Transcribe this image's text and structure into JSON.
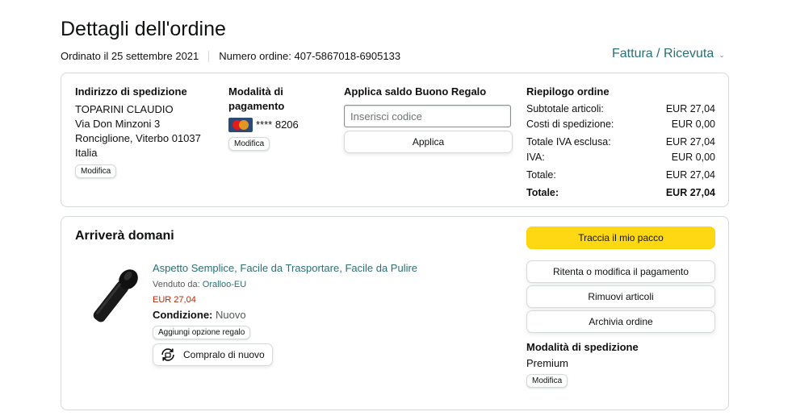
{
  "header": {
    "title": "Dettagli dell'ordine",
    "ordered_on": "Ordinato il 25 settembre 2021",
    "order_number": "Numero ordine: 407-5867018-6905133",
    "invoice_label": "Fattura / Ricevuta"
  },
  "shipping_address": {
    "title": "Indirizzo di spedizione",
    "name": "TOPARINI CLAUDIO",
    "street": "Via Don Minzoni 3",
    "city": "Ronciglione, Viterbo 01037",
    "country": "Italia",
    "edit_label": "Modifica"
  },
  "payment": {
    "title_line1": "Modalità di",
    "title_line2": "pagamento",
    "card_brand": "mastercard",
    "card_digits": "**** 8206",
    "edit_label": "Modifica"
  },
  "gift_card": {
    "title": "Applica saldo Buono Regalo",
    "placeholder": "Inserisci codice",
    "apply_label": "Applica"
  },
  "summary": {
    "title": "Riepilogo ordine",
    "rows": [
      {
        "label": "Subtotale articoli:",
        "value": "EUR 27,04"
      },
      {
        "label": "Costi di spedizione:",
        "value": "EUR 0,00"
      },
      {
        "label": "Totale IVA esclusa:",
        "value": "EUR 27,04"
      },
      {
        "label": "IVA:",
        "value": "EUR 0,00"
      },
      {
        "label": "Totale:",
        "value": "EUR 27,04"
      },
      {
        "label": "Totale:",
        "value": "EUR 27,04"
      }
    ]
  },
  "shipment": {
    "status": "Arriverà domani",
    "item": {
      "title": "Aspetto Semplice, Facile da Trasportare, Facile da Pulire",
      "sold_by_label": "Venduto da:",
      "seller": "Oralloo-EU",
      "price": "EUR 27,04",
      "condition_label": "Condizione:",
      "condition": "Nuovo",
      "gift_option_label": "Aggiungi opzione regalo",
      "buy_again_label": "Compralo di nuovo"
    },
    "actions": {
      "track": "Traccia il mio pacco",
      "retry_payment": "Ritenta o modifica il pagamento",
      "remove_items": "Rimuovi articoli",
      "archive": "Archivia ordine"
    },
    "shipping_method": {
      "title": "Modalità di spedizione",
      "value": "Premium",
      "edit_label": "Modifica"
    }
  },
  "colors": {
    "link": "#2a6f74",
    "price": "#b12704",
    "track_button": "#ffd814",
    "border": "#d5d9d9"
  }
}
